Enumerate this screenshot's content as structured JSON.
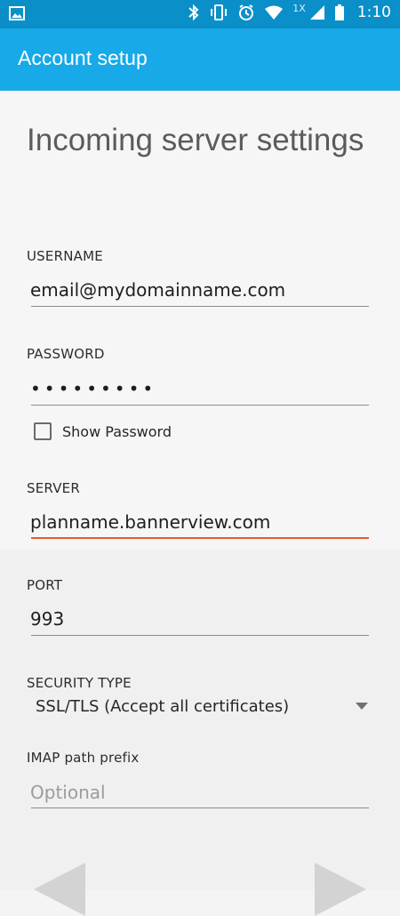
{
  "status_bar": {
    "time": "1:10",
    "network_label": "1X"
  },
  "app_bar": {
    "title": "Account setup"
  },
  "page": {
    "heading": "Incoming server settings",
    "username_label": "USERNAME",
    "username_value": "email@mydomainname.com",
    "password_label": "PASSWORD",
    "password_value": "•••••••••",
    "show_password_label": "Show Password",
    "server_label": "SERVER",
    "server_value": "planname.bannerview.com",
    "port_label": "PORT",
    "port_value": "993",
    "security_label": "SECURITY TYPE",
    "security_value": "SSL/TLS (Accept all certificates)",
    "imap_prefix_label": "IMAP path prefix",
    "imap_prefix_placeholder": "Optional"
  },
  "colors": {
    "status_bar": "#0a8fc9",
    "app_bar": "#17a9e8",
    "active_underline": "#e85a2c"
  },
  "icons": [
    "image-icon",
    "bluetooth-icon",
    "vibrate-icon",
    "alarm-icon",
    "wifi-icon",
    "signal-icon",
    "battery-icon",
    "dropdown-arrow-icon",
    "back-arrow-icon",
    "next-arrow-icon"
  ]
}
